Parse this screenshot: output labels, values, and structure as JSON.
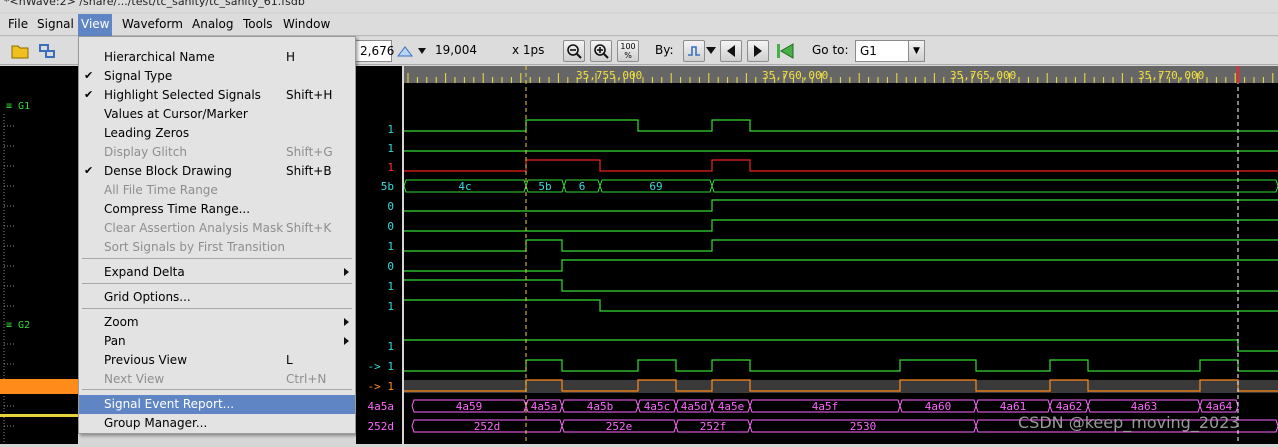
{
  "window": {
    "title": "*<nWave:2> /share/.../test/tc_sanity/tc_sanity_61.fsdb"
  },
  "menubar": [
    {
      "label": "File",
      "name": "menu-file"
    },
    {
      "label": "Signal",
      "name": "menu-signal"
    },
    {
      "label": "View",
      "name": "menu-view"
    },
    {
      "label": "Waveform",
      "name": "menu-waveform"
    },
    {
      "label": "Analog",
      "name": "menu-analog"
    },
    {
      "label": "Tools",
      "name": "menu-tools"
    },
    {
      "label": "Window",
      "name": "menu-window"
    }
  ],
  "toolbar": {
    "cursor_time": "2,676",
    "marker_time": "19,004",
    "time_unit": "x 1ps",
    "by_label": "By:",
    "goto_label": "Go to:",
    "goto_value": "G1",
    "zoom_fit_label": "100 %"
  },
  "view_menu": {
    "items": [
      {
        "label": "Hierarchical Name",
        "shortcut": "H",
        "checked": false,
        "disabled": false,
        "submenu": false
      },
      {
        "label": "Signal Type",
        "shortcut": "",
        "checked": true,
        "disabled": false,
        "submenu": false
      },
      {
        "label": "Highlight Selected Signals",
        "shortcut": "Shift+H",
        "checked": true,
        "disabled": false,
        "submenu": false
      },
      {
        "label": "Values at Cursor/Marker",
        "shortcut": "",
        "checked": false,
        "disabled": false,
        "submenu": false
      },
      {
        "label": "Leading Zeros",
        "shortcut": "",
        "checked": false,
        "disabled": false,
        "submenu": false
      },
      {
        "label": "Display Glitch",
        "shortcut": "Shift+G",
        "checked": false,
        "disabled": true,
        "submenu": false
      },
      {
        "label": "Dense Block Drawing",
        "shortcut": "Shift+B",
        "checked": true,
        "disabled": false,
        "submenu": false
      },
      {
        "label": "All File Time Range",
        "shortcut": "",
        "checked": false,
        "disabled": true,
        "submenu": false
      },
      {
        "label": "Compress Time Range...",
        "shortcut": "",
        "checked": false,
        "disabled": false,
        "submenu": false
      },
      {
        "label": "Clear Assertion Analysis Mask",
        "shortcut": "Shift+K",
        "checked": false,
        "disabled": true,
        "submenu": false
      },
      {
        "label": "Sort Signals by First Transition",
        "shortcut": "",
        "checked": false,
        "disabled": true,
        "submenu": false
      },
      {
        "label": "Expand Delta",
        "shortcut": "",
        "checked": false,
        "disabled": false,
        "submenu": true
      },
      {
        "label": "Grid Options...",
        "shortcut": "",
        "checked": false,
        "disabled": false,
        "submenu": false
      },
      {
        "label": "Zoom",
        "shortcut": "",
        "checked": false,
        "disabled": false,
        "submenu": true
      },
      {
        "label": "Pan",
        "shortcut": "",
        "checked": false,
        "disabled": false,
        "submenu": true
      },
      {
        "label": "Previous View",
        "shortcut": "L",
        "checked": false,
        "disabled": false,
        "submenu": false
      },
      {
        "label": "Next View",
        "shortcut": "Ctrl+N",
        "checked": false,
        "disabled": true,
        "submenu": false
      },
      {
        "label": "Signal Event Report...",
        "shortcut": "",
        "checked": false,
        "disabled": false,
        "submenu": false,
        "highlighted": true
      },
      {
        "label": "Group Manager...",
        "shortcut": "",
        "checked": false,
        "disabled": false,
        "submenu": false
      }
    ]
  },
  "groups": [
    {
      "label": "G1"
    },
    {
      "label": "G2"
    }
  ],
  "timeline": {
    "labels": [
      "35,755,000",
      "35,760,000",
      "35,765,000",
      "35,770,000"
    ]
  },
  "signal_values": [
    {
      "value": "1",
      "color": "#33dddd"
    },
    {
      "value": "1",
      "color": "#33dddd"
    },
    {
      "value": "1",
      "color": "#ff3333"
    },
    {
      "value": "5b",
      "color": "#33dddd"
    },
    {
      "value": "0",
      "color": "#33dddd"
    },
    {
      "value": "0",
      "color": "#33dddd"
    },
    {
      "value": "1",
      "color": "#33dddd"
    },
    {
      "value": "0",
      "color": "#33dddd"
    },
    {
      "value": "1",
      "color": "#33dddd"
    },
    {
      "value": "1",
      "color": "#33dddd"
    },
    {
      "value": "1",
      "color": "#33dddd"
    },
    {
      "value": "-> 1",
      "color": "#33dddd"
    },
    {
      "value": "-> 1",
      "color": "#ff8c1a"
    },
    {
      "value": "4a5a",
      "color": "#ff66ff"
    },
    {
      "value": "252d",
      "color": "#ff66ff"
    }
  ],
  "bus_values": {
    "row3": [
      "4c",
      "5b",
      "6",
      "69"
    ],
    "row13": [
      "4a59",
      "4a5a",
      "4a5b",
      "4a5c",
      "4a5d",
      "4a5e",
      "4a5f",
      "4a60",
      "4a61",
      "4a62",
      "4a63",
      "4a64"
    ],
    "row14": [
      "252d",
      "252e",
      "252f",
      "2530"
    ]
  },
  "colors": {
    "green_wave": "#33dd33",
    "red_wave": "#ee2222",
    "cyan_bus": "#33dddd",
    "orange_row": "#ff8c1a",
    "magenta_bus": "#ff66ff",
    "cursor_yellow": "#e8d23a",
    "marker_red": "#ff2222",
    "timeline_bg": "#666666",
    "timeline_text": "#f0e040"
  },
  "watermark": "CSDN @keep_moving_2023"
}
